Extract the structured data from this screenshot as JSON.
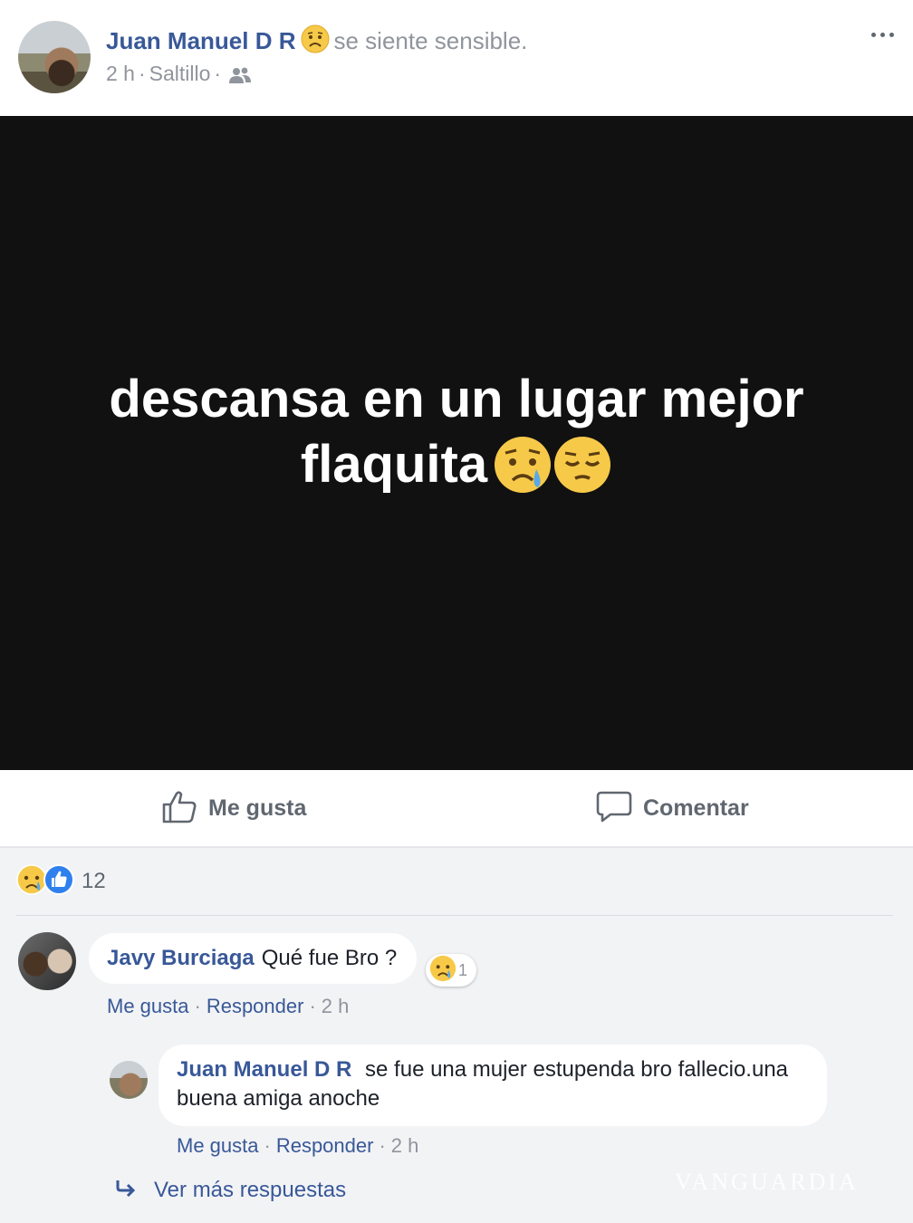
{
  "post": {
    "author": "Juan Manuel D R",
    "feeling": "se siente sensible.",
    "time": "2 h",
    "location": "Saltillo",
    "separator": "·",
    "text_line1": "descansa en un lugar mejor",
    "text_line2": "flaquita",
    "background_color": "#111112"
  },
  "actions": {
    "like_label": "Me gusta",
    "comment_label": "Comentar"
  },
  "reactions": {
    "count": "12",
    "types": [
      "sad-reaction",
      "like-reaction"
    ]
  },
  "comments": [
    {
      "author": "Javy Burciaga",
      "text": "Qué fue Bro ?",
      "reaction_count": "1",
      "like_link": "Me gusta",
      "reply_link": "Responder",
      "time": "2 h"
    }
  ],
  "replies": [
    {
      "author": "Juan Manuel D R",
      "text": "se fue una mujer estupenda bro fallecio.una buena amiga anoche",
      "like_link": "Me gusta",
      "reply_link": "Responder",
      "time": "2 h"
    }
  ],
  "more_replies_label": "Ver más respuestas",
  "watermark": "VANGUARDIA",
  "colors": {
    "link_blue": "#385898",
    "meta_gray": "#90949c",
    "comment_bg": "#f2f3f5"
  }
}
